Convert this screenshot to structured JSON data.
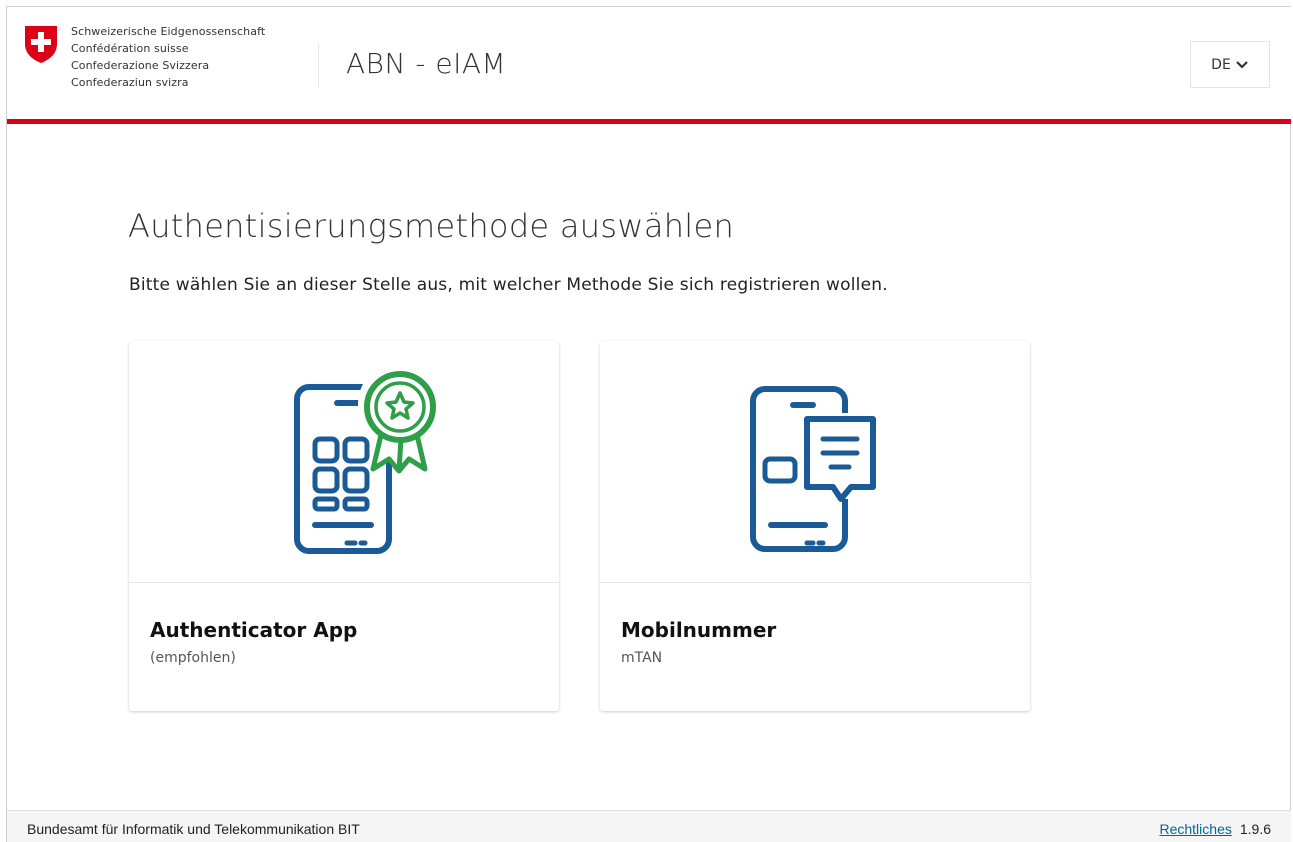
{
  "header": {
    "federation_lines": [
      "Schweizerische Eidgenossenschaft",
      "Confédération suisse",
      "Confederazione Svizzera",
      "Confederaziun svizra"
    ],
    "app_title": "ABN - eIAM",
    "language": "DE",
    "icons": [
      "swiss-cross-icon",
      "chevron-down-icon"
    ]
  },
  "main": {
    "title": "Authentisierungsmethode auswählen",
    "subtitle": "Bitte wählen Sie an dieser Stelle aus, mit welcher Methode Sie sich registrieren wollen.",
    "cards": [
      {
        "title": "Authenticator App",
        "subtitle": "(empfohlen)",
        "icon": "authenticator-app-icon"
      },
      {
        "title": "Mobilnummer",
        "subtitle": "mTAN",
        "icon": "mobile-sms-icon"
      }
    ]
  },
  "footer": {
    "org": "Bundesamt für Informatik und Telekommunikation BIT",
    "legal_link": "Rechtliches",
    "version": "1.9.6"
  },
  "colors": {
    "accent_red": "#dc0018",
    "icon_blue": "#1a5a96",
    "icon_green": "#2e9e48",
    "link": "#006699"
  }
}
